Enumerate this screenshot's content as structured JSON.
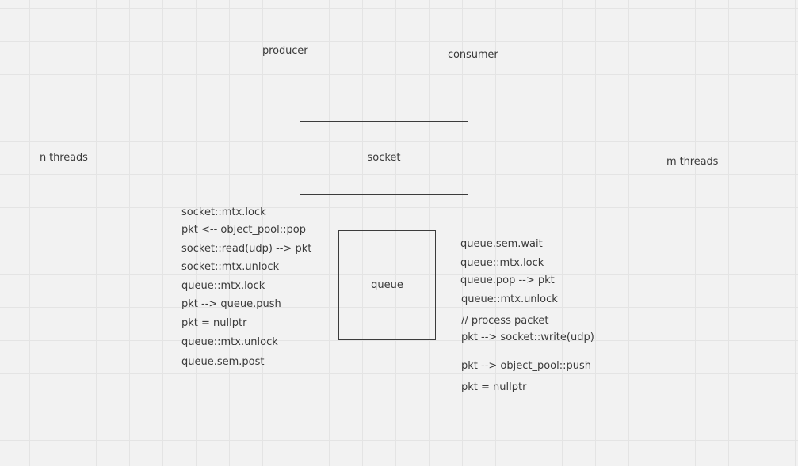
{
  "labels": {
    "producer": "producer",
    "consumer": "consumer",
    "n_threads": "n threads",
    "m_threads": "m threads"
  },
  "boxes": {
    "socket": "socket",
    "queue": "queue"
  },
  "producer_steps": [
    "socket::mtx.lock",
    "pkt <-- object_pool::pop",
    "socket::read(udp) -->  pkt",
    "socket::mtx.unlock",
    "queue::mtx.lock",
    "pkt --> queue.push",
    "pkt = nullptr",
    "queue::mtx.unlock",
    "queue.sem.post"
  ],
  "consumer_steps": [
    "queue.sem.wait",
    "queue::mtx.lock",
    "queue.pop --> pkt",
    "queue::mtx.unlock",
    "// process packet",
    "pkt --> socket::write(udp)",
    "pkt --> object_pool::push",
    "pkt = nullptr"
  ]
}
